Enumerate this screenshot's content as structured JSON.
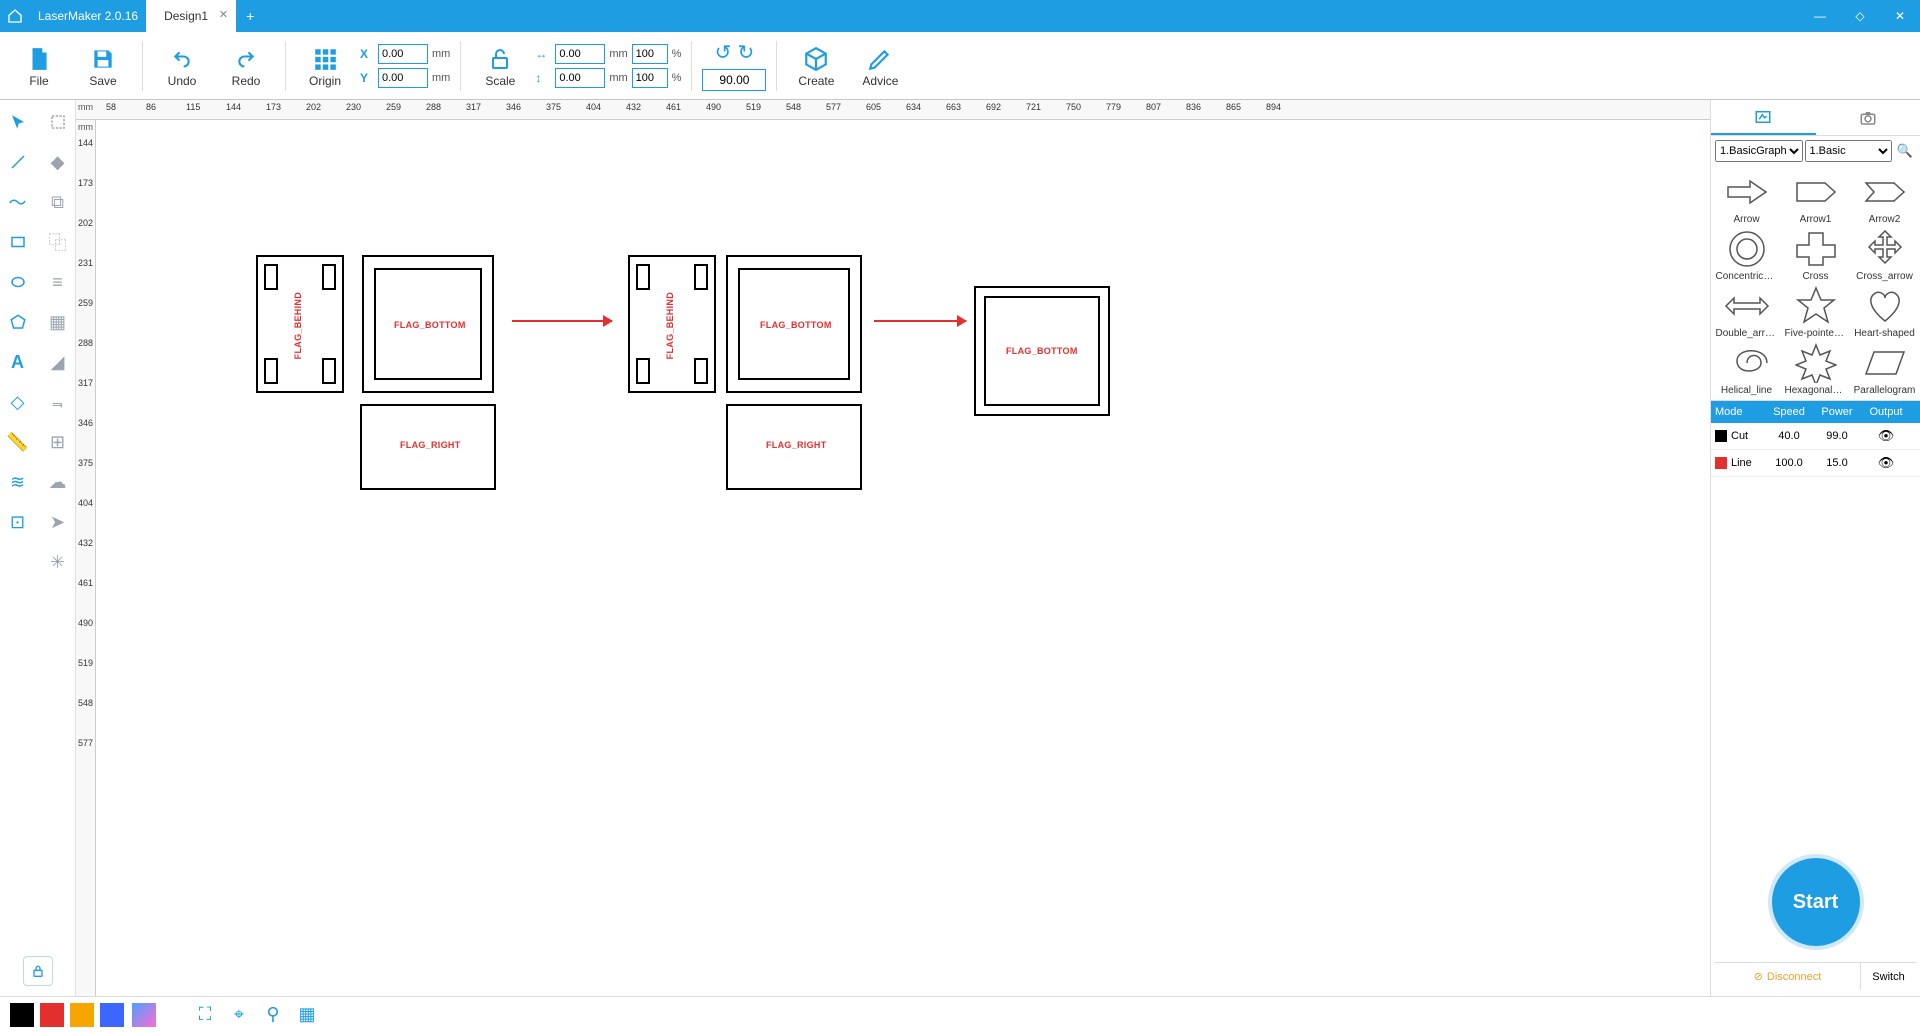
{
  "app": {
    "title": "LaserMaker 2.0.16",
    "tab": "Design1"
  },
  "toolbar": {
    "file": "File",
    "save": "Save",
    "undo": "Undo",
    "redo": "Redo",
    "origin": "Origin",
    "scale": "Scale",
    "create": "Create",
    "advice": "Advice",
    "x": "0.00",
    "y": "0.00",
    "w": "0.00",
    "h": "0.00",
    "sx": "100",
    "sy": "100",
    "angle": "90.00",
    "mm": "mm",
    "pct": "%",
    "xl": "X",
    "yl": "Y"
  },
  "ruler_h": [
    58,
    86,
    115,
    144,
    173,
    202,
    230,
    259,
    288,
    317,
    346,
    375,
    404,
    432,
    461,
    490,
    519,
    548,
    577,
    605,
    634,
    663,
    692,
    721,
    750,
    779,
    807,
    836,
    865,
    894
  ],
  "ruler_v": [
    144,
    173,
    202,
    231,
    259,
    288,
    317,
    346,
    375,
    404,
    432,
    461,
    490,
    519,
    548,
    577
  ],
  "ruler_mm": "mm",
  "flags": {
    "behind": "FLAG_BEHIND",
    "bottom": "FLAG_BOTTOM",
    "right": "FLAG_RIGHT"
  },
  "shape_cats": {
    "a": "1.BasicGraph",
    "b": "1.Basic"
  },
  "shapes": [
    {
      "n": "Arrow"
    },
    {
      "n": "Arrow1"
    },
    {
      "n": "Arrow2"
    },
    {
      "n": "Concentric_circle"
    },
    {
      "n": "Cross"
    },
    {
      "n": "Cross_arrow"
    },
    {
      "n": "Double_arrow"
    },
    {
      "n": "Five-pointed_star"
    },
    {
      "n": "Heart-shaped"
    },
    {
      "n": "Helical_line"
    },
    {
      "n": "Hexagonal_star"
    },
    {
      "n": "Parallelogram"
    }
  ],
  "layers": {
    "head": {
      "mode": "Mode",
      "speed": "Speed",
      "power": "Power",
      "output": "Output"
    },
    "rows": [
      {
        "color": "#000000",
        "name": "Cut",
        "speed": "40.0",
        "power": "99.0"
      },
      {
        "color": "#e42f2f",
        "name": "Line",
        "speed": "100.0",
        "power": "15.0"
      }
    ]
  },
  "start": "Start",
  "conn": {
    "disc": "Disconnect",
    "switch": "Switch"
  },
  "colors": [
    "#000000",
    "#e42f2f",
    "#f7a500",
    "#3b66ff"
  ]
}
